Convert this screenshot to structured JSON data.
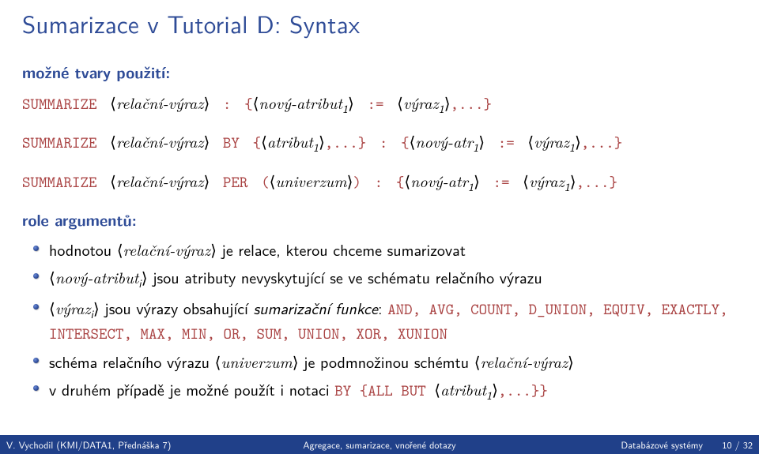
{
  "title": "Sumarizace v Tutorial D: Syntax",
  "section_forms": "možné tvary použití:",
  "code": {
    "kw": {
      "summarize": "SUMMARIZE",
      "by": "BY",
      "per": "PER"
    },
    "relexpr": "relační-výraz",
    "novy_atribut": "nový-atribut",
    "atribut": "atribut",
    "novy_atr": "nový-atr",
    "vyraz": "výraz",
    "univerzum": "univerzum",
    "sub1": "1",
    "subi": "i",
    "assign": ":=",
    "lbrace": "{",
    "rbrace": "}",
    "lparen": "(",
    "rparen": ")",
    "lang": "⟨",
    "rang": "⟩",
    "colon": ":",
    "comma_dots": ",...",
    "comma_dots_rbrace": ",...}"
  },
  "section_args": "role argumentů:",
  "bullets": {
    "b1a": "hodnotou ",
    "b1b": " je relace, kterou chceme sumarizovat",
    "b2a": "",
    "b2b": " jsou atributy nevyskytující se ve schématu relačního výrazu",
    "b3a": "",
    "b3b": " jsou výrazy obsahující ",
    "b3emph": "sumarizační funkce",
    "b3c": ": ",
    "b3funcs": "AND, AVG, COUNT, D_UNION, EQUIV, EXACTLY, INTERSECT, MAX, MIN, OR, SUM, UNION, XOR, XUNION",
    "b4a": "schéma relačního výrazu ",
    "b4b": " je podmnožinou schémtu ",
    "b5a": "v druhém případě je možné použít i notaci ",
    "b5kw": "BY {ALL BUT ",
    "b5tail": ",...}}"
  },
  "footer": {
    "left": "V. Vychodil (KMI/DATA1, Přednáška 7)",
    "middle": "Agregace, sumarizace, vnořené dotazy",
    "right_label": "Databázové systémy",
    "right_page": "10 / 32"
  }
}
